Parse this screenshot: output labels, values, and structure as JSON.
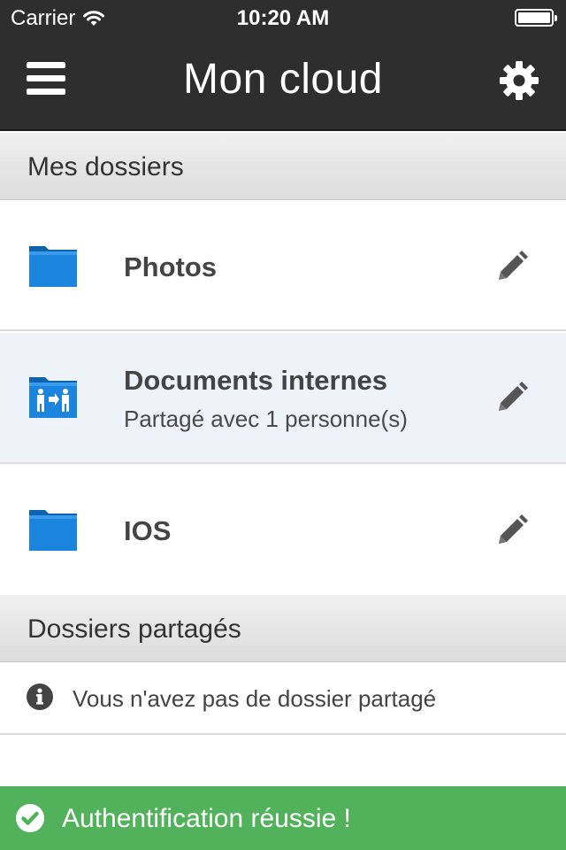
{
  "status_bar": {
    "carrier": "Carrier",
    "time": "10:20 AM"
  },
  "nav": {
    "title": "Mon cloud",
    "menu_icon": "hamburger-icon",
    "settings_icon": "gear-icon"
  },
  "sections": {
    "my_folders": "Mes dossiers",
    "shared_folders": "Dossiers partagés"
  },
  "folders": [
    {
      "name": "Photos",
      "subtitle": "",
      "icon": "folder-icon",
      "shared": false
    },
    {
      "name": "Documents internes",
      "subtitle": "Partagé avec 1 personne(s)",
      "icon": "shared-folder-icon",
      "shared": true
    },
    {
      "name": "IOS",
      "subtitle": "",
      "icon": "folder-icon",
      "shared": false
    }
  ],
  "shared_empty": {
    "icon": "info-icon",
    "text": "Vous n'avez pas de dossier partagé"
  },
  "toast": {
    "icon": "check-circle-icon",
    "text": "Authentification réussie !"
  },
  "colors": {
    "nav_background": "#2e2e2e",
    "folder_blue": "#1b7fd6",
    "highlight_row": "#eef2f9",
    "toast_green": "#52b15b"
  }
}
